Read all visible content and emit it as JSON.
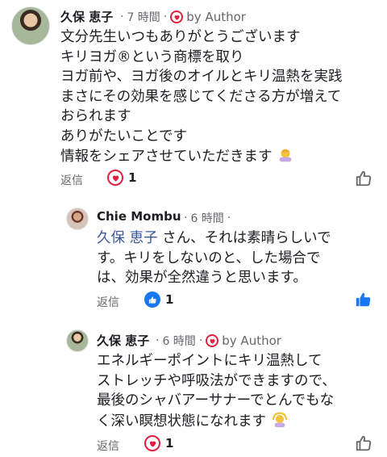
{
  "comments": [
    {
      "author": "久保 恵子",
      "time": "7 時間",
      "badge": "by Author",
      "lines": [
        "文分先生いつもありがとうございます",
        "キリヨガ®という商標を取り",
        "ヨガ前や、ヨガ後のオイルとキリ温熱を実践",
        "まさにその効果を感じてくださる方が増えて",
        "おられます",
        "ありがたいことです",
        "情報をシェアさせていただきます"
      ],
      "reply": "返信",
      "reaction_count": "1",
      "reaction_type": "heart-icon"
    },
    {
      "author": "Chie Mombu",
      "time": "6 時間",
      "mention": "久保 恵子",
      "lines": [
        " さん、それは素晴らしいで",
        "す。キリをしないのと、した場合で",
        "は、効果が全然違うと思います。"
      ],
      "reply": "返信",
      "reaction_count": "1",
      "reaction_type": "thumbs-up-icon"
    },
    {
      "author": "久保 恵子",
      "time": "6 時間",
      "badge": "by Author",
      "lines": [
        "エネルギーポイントにキリ温熱して",
        "ストレッチや呼吸法ができますので、",
        "最後のシャバアーサナーでとんでもな",
        "く深い瞑想状態になれます"
      ],
      "reply": "返信",
      "reaction_count": "1",
      "reaction_type": "heart-icon"
    }
  ],
  "colors": {
    "heart": "#e41e3f",
    "like": "#1877f2",
    "meta": "#65676b",
    "mention": "#385898"
  }
}
